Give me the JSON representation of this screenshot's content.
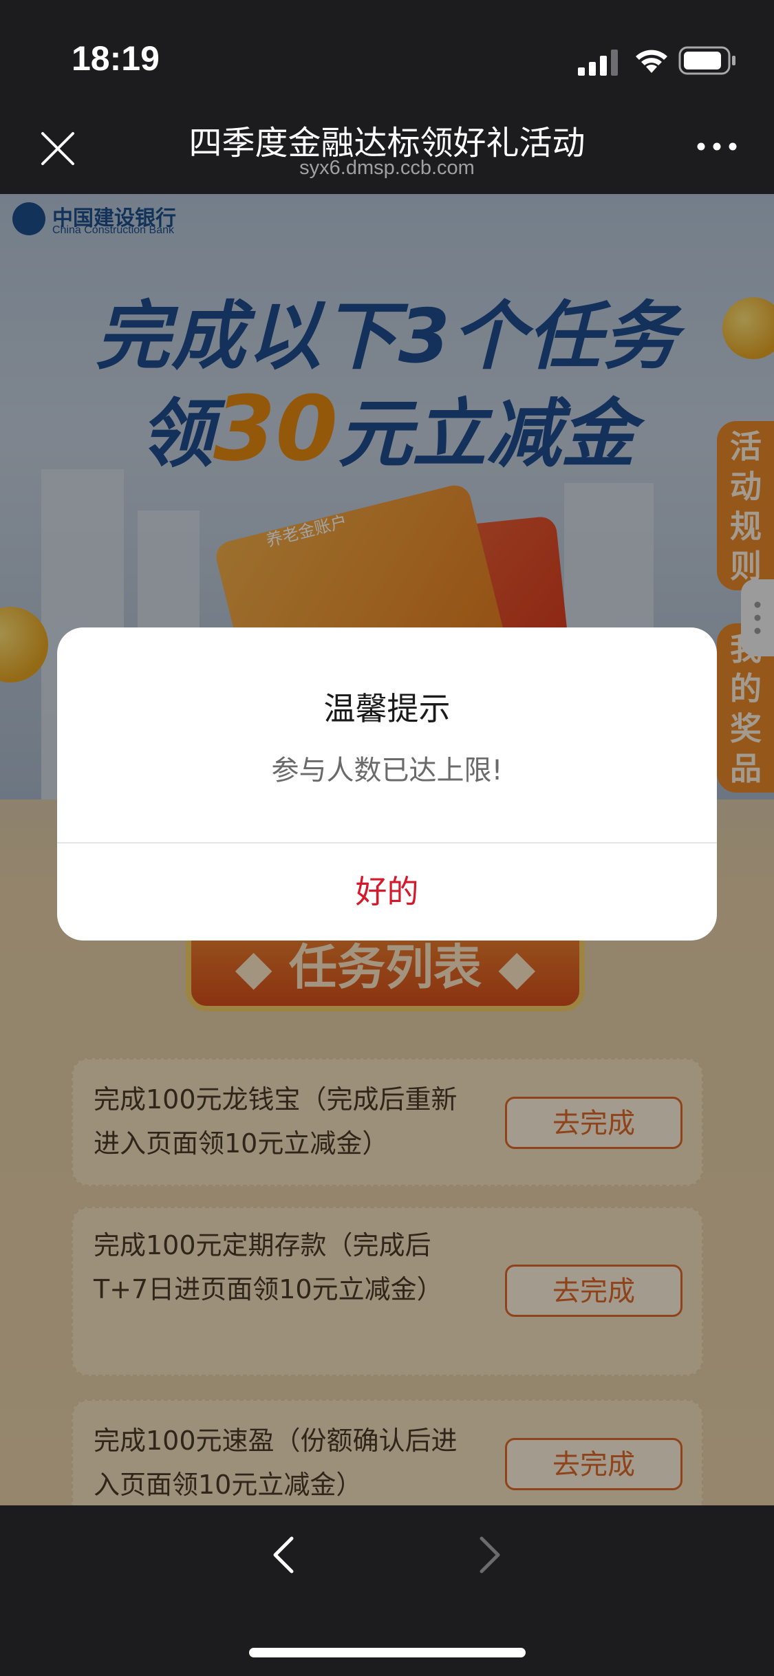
{
  "status": {
    "time": "18:19"
  },
  "nav": {
    "title": "四季度金融达标领好礼活动",
    "url": "syx6.dmsp.ccb.com"
  },
  "banner": {
    "bank_name_cn": "中国建设银行",
    "bank_name_en": "China Construction Bank",
    "headline_line1": "完成以下3个任务",
    "headline_line2_prefix": "领",
    "headline_line2_amount": "30",
    "headline_line2_suffix": "元立减金",
    "card_label": "养老金账户"
  },
  "side_tabs": {
    "rules": "活动规则",
    "prizes": "我的奖品"
  },
  "task_section": {
    "title": "◆ 任务列表 ◆"
  },
  "tasks": [
    {
      "text": "完成100元龙钱宝（完成后重新进入页面领10元立减金）",
      "button": "去完成"
    },
    {
      "text": "完成100元定期存款（完成后T+7日进页面领10元立减金）",
      "button": "去完成"
    },
    {
      "text": "完成100元速盈（份额确认后进入页面领10元立减金）",
      "button": "去完成"
    }
  ],
  "dialog": {
    "title": "温馨提示",
    "message": "参与人数已达上限!",
    "ok": "好的"
  },
  "colors": {
    "dialog_accent": "#d6182b",
    "brand_blue": "#1f4e8f",
    "task_orange": "#e0692a"
  }
}
